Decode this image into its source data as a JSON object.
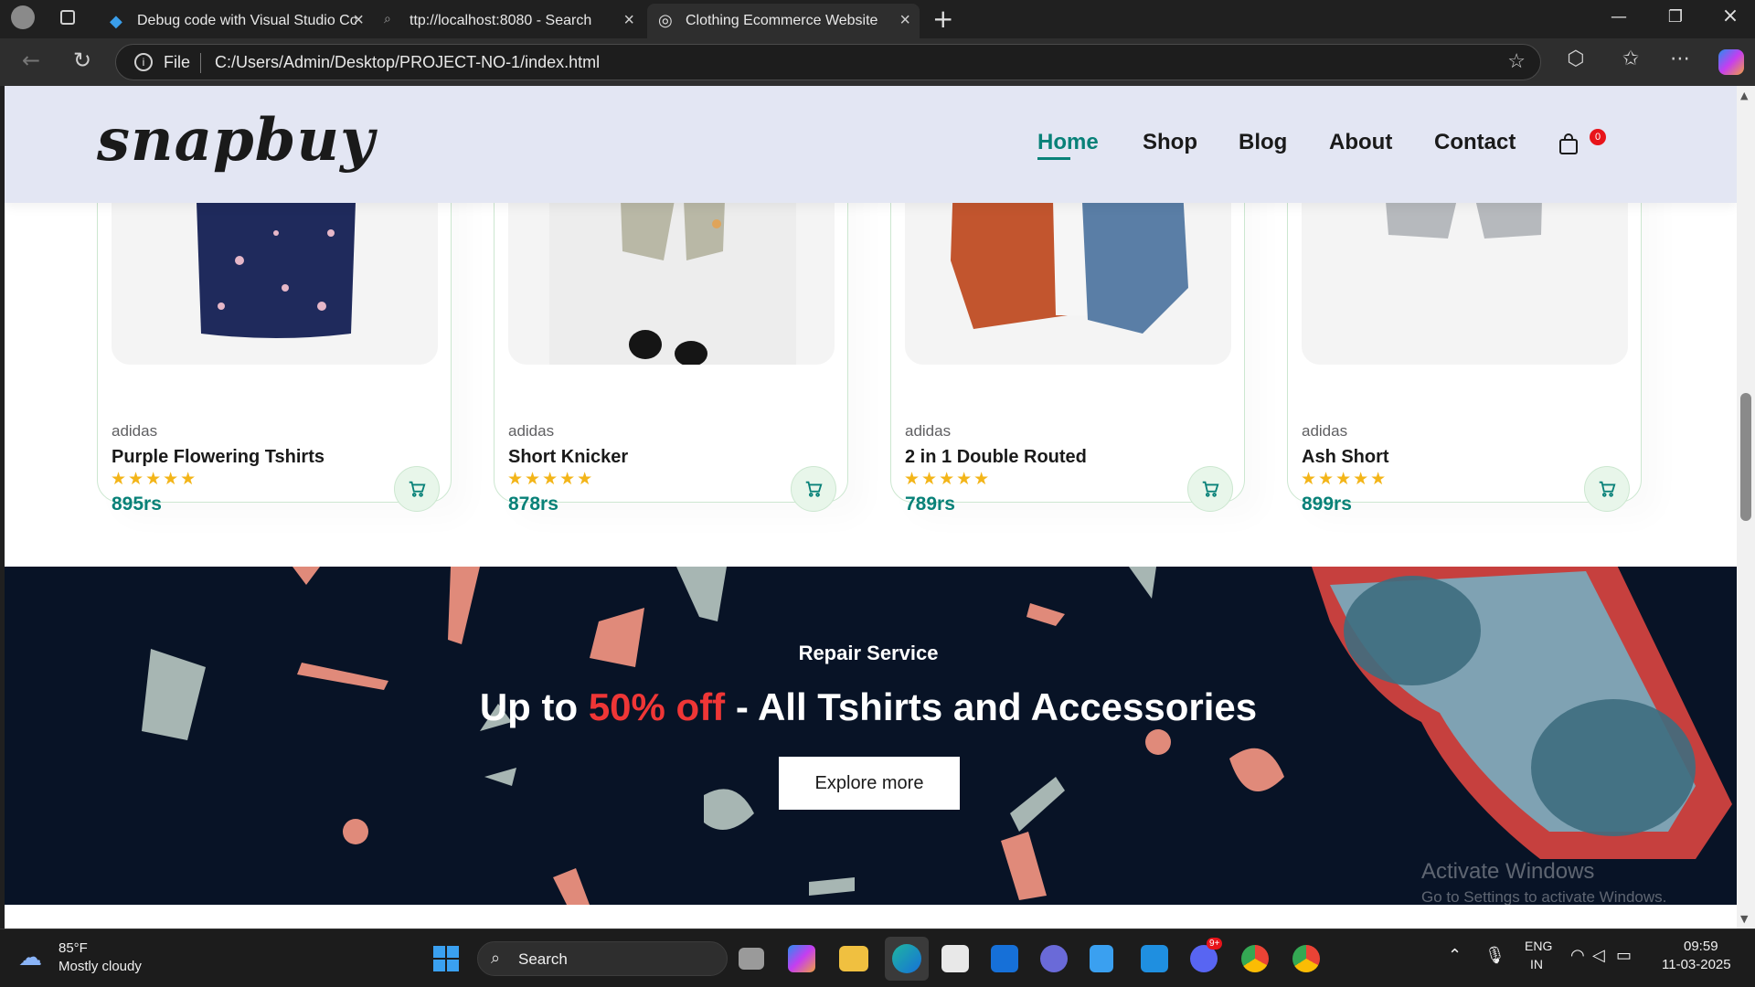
{
  "browser": {
    "tabs": [
      {
        "label": "Debug code with Visual Studio Code",
        "active": false
      },
      {
        "label": "ttp://localhost:8080 - Search",
        "active": false
      },
      {
        "label": "Clothing Ecommerce Website",
        "active": true
      }
    ],
    "address": {
      "scheme_label": "File",
      "url": "C:/Users/Admin/Desktop/PROJECT-NO-1/index.html"
    }
  },
  "site": {
    "logo": "snapbuy",
    "nav": {
      "home": "Home",
      "shop": "Shop",
      "blog": "Blog",
      "about": "About",
      "contact": "Contact",
      "cart_count": "0"
    },
    "products": [
      {
        "brand": "adidas",
        "name": "Purple Flowering Tshirts",
        "stars": "★★★★★",
        "price": "895rs"
      },
      {
        "brand": "adidas",
        "name": "Short Knicker",
        "stars": "★★★★★",
        "price": "878rs"
      },
      {
        "brand": "adidas",
        "name": "2 in 1 Double Routed",
        "stars": "★★★★★",
        "price": "789rs"
      },
      {
        "brand": "adidas",
        "name": "Ash Short",
        "stars": "★★★★★",
        "price": "899rs"
      }
    ],
    "banner": {
      "subtitle": "Repair Service",
      "title_prefix": "Up to ",
      "title_highlight": "50% off",
      "title_suffix": " - All Tshirts and Accessories",
      "button": "Explore more"
    },
    "watermark": {
      "line1": "Activate Windows",
      "line2": "Go to Settings to activate Windows."
    }
  },
  "taskbar": {
    "weather": {
      "temp": "85°F",
      "condition": "Mostly cloudy"
    },
    "search_label": "Search",
    "lang": {
      "line1": "ENG",
      "line2": "IN"
    },
    "time": "09:59",
    "date": "11-03-2025",
    "discord_badge": "9+"
  },
  "colors": {
    "accent": "#088178",
    "header_bg": "#e3e6f3",
    "banner_bg": "#081326",
    "price_highlight": "#ef3636",
    "star": "#f3b519"
  }
}
